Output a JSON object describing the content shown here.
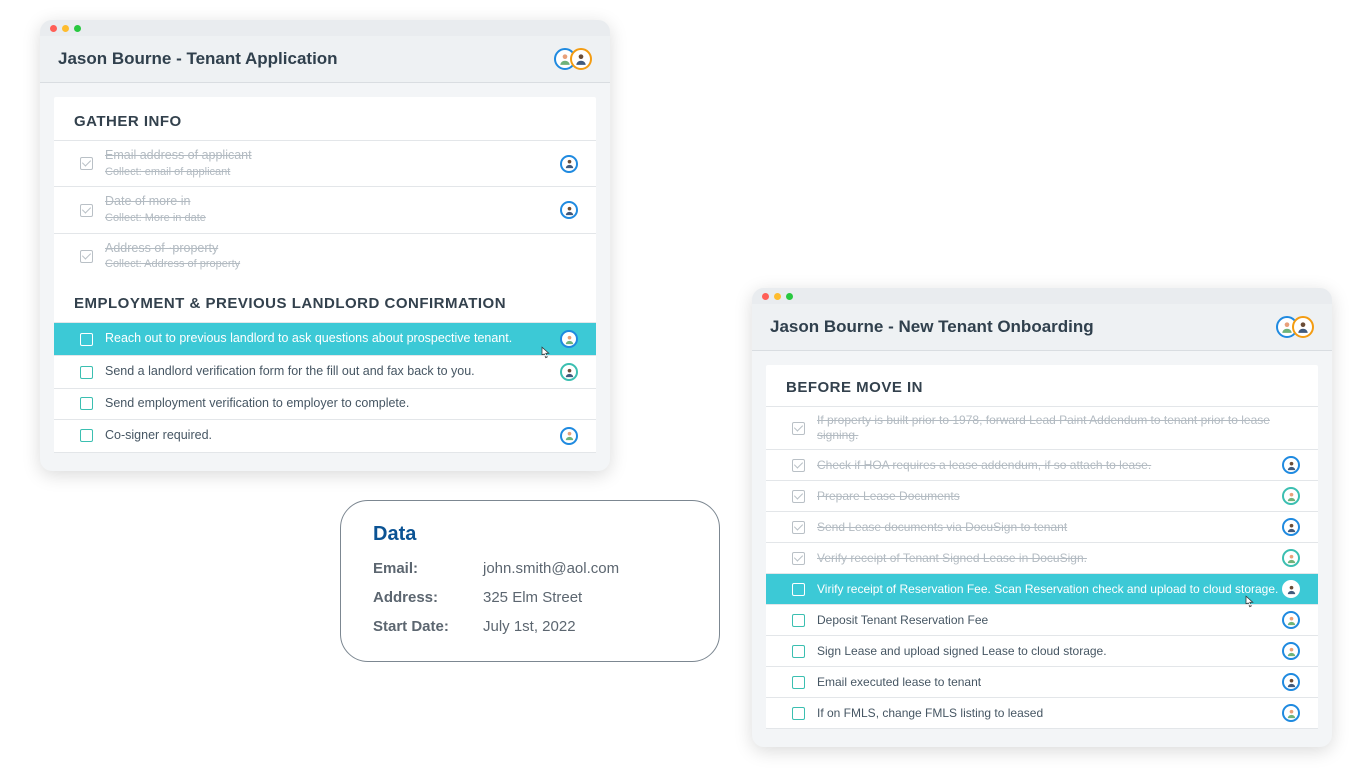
{
  "window_left": {
    "title": "Jason Bourne - Tenant Application",
    "sections": [
      {
        "title": "GATHER INFO",
        "rows": [
          {
            "label": "Email address of applicant",
            "sub": "Collect: email of applicant",
            "done": true,
            "active": false,
            "avatar": true
          },
          {
            "label": "Date of more in",
            "sub": "Collect: More in date",
            "done": true,
            "active": false,
            "avatar": true
          },
          {
            "label": "Address of ·property",
            "sub": "Collect: Address of property",
            "done": true,
            "active": false,
            "avatar": false
          }
        ]
      },
      {
        "title": "EMPLOYMENT & PREVIOUS LANDLORD CONFIRMATION",
        "rows": [
          {
            "label": "Reach out to previous landlord to ask questions about prospective tenant.",
            "done": false,
            "active": true,
            "avatar": true,
            "cursor": true
          },
          {
            "label": "Send a landlord verification form for the fill out and fax back to you.",
            "done": false,
            "active": false,
            "avatar": true
          },
          {
            "label": "Send employment verification to employer to complete.",
            "done": false,
            "active": false,
            "avatar": false
          },
          {
            "label": "Co-signer required.",
            "done": false,
            "active": false,
            "avatar": true
          }
        ]
      }
    ]
  },
  "window_right": {
    "title": "Jason Bourne - New Tenant Onboarding",
    "sections": [
      {
        "title": "BEFORE MOVE IN",
        "rows": [
          {
            "label": "If property is built prior to 1978, forward Lead Paint Addendum to tenant prior to lease signing.",
            "done": true,
            "active": false,
            "avatar": false
          },
          {
            "label": "Check if HOA requires a lease addendum, if so attach to lease.",
            "done": true,
            "active": false,
            "avatar": true
          },
          {
            "label": "Prepare Lease Documents",
            "done": true,
            "active": false,
            "avatar": true
          },
          {
            "label": "Send Lease documents via DocuSign to tenant",
            "done": true,
            "active": false,
            "avatar": true
          },
          {
            "label": "Verify receipt of Tenant Signed Lease in DocuSign.",
            "done": true,
            "active": false,
            "avatar": true
          },
          {
            "label": "Virify receipt of Reservation Fee. Scan Reservation check and upload to cloud storage.",
            "done": false,
            "active": true,
            "avatar": true,
            "cursor": true
          },
          {
            "label": "Deposit Tenant Reservation Fee",
            "done": false,
            "active": false,
            "avatar": true
          },
          {
            "label": "Sign Lease and upload signed Lease to cloud storage.",
            "done": false,
            "active": false,
            "avatar": true
          },
          {
            "label": "Email executed lease to tenant",
            "done": false,
            "active": false,
            "avatar": true
          },
          {
            "label": "If on FMLS, change FMLS listing to leased",
            "done": false,
            "active": false,
            "avatar": true
          }
        ]
      }
    ]
  },
  "data_bubble": {
    "title": "Data",
    "email_label": "Email:",
    "email_value": "john.smith@aol.com",
    "address_label": "Address:",
    "address_value": "325 Elm Street",
    "start_label": "Start Date:",
    "start_value": "July 1st, 2022"
  }
}
